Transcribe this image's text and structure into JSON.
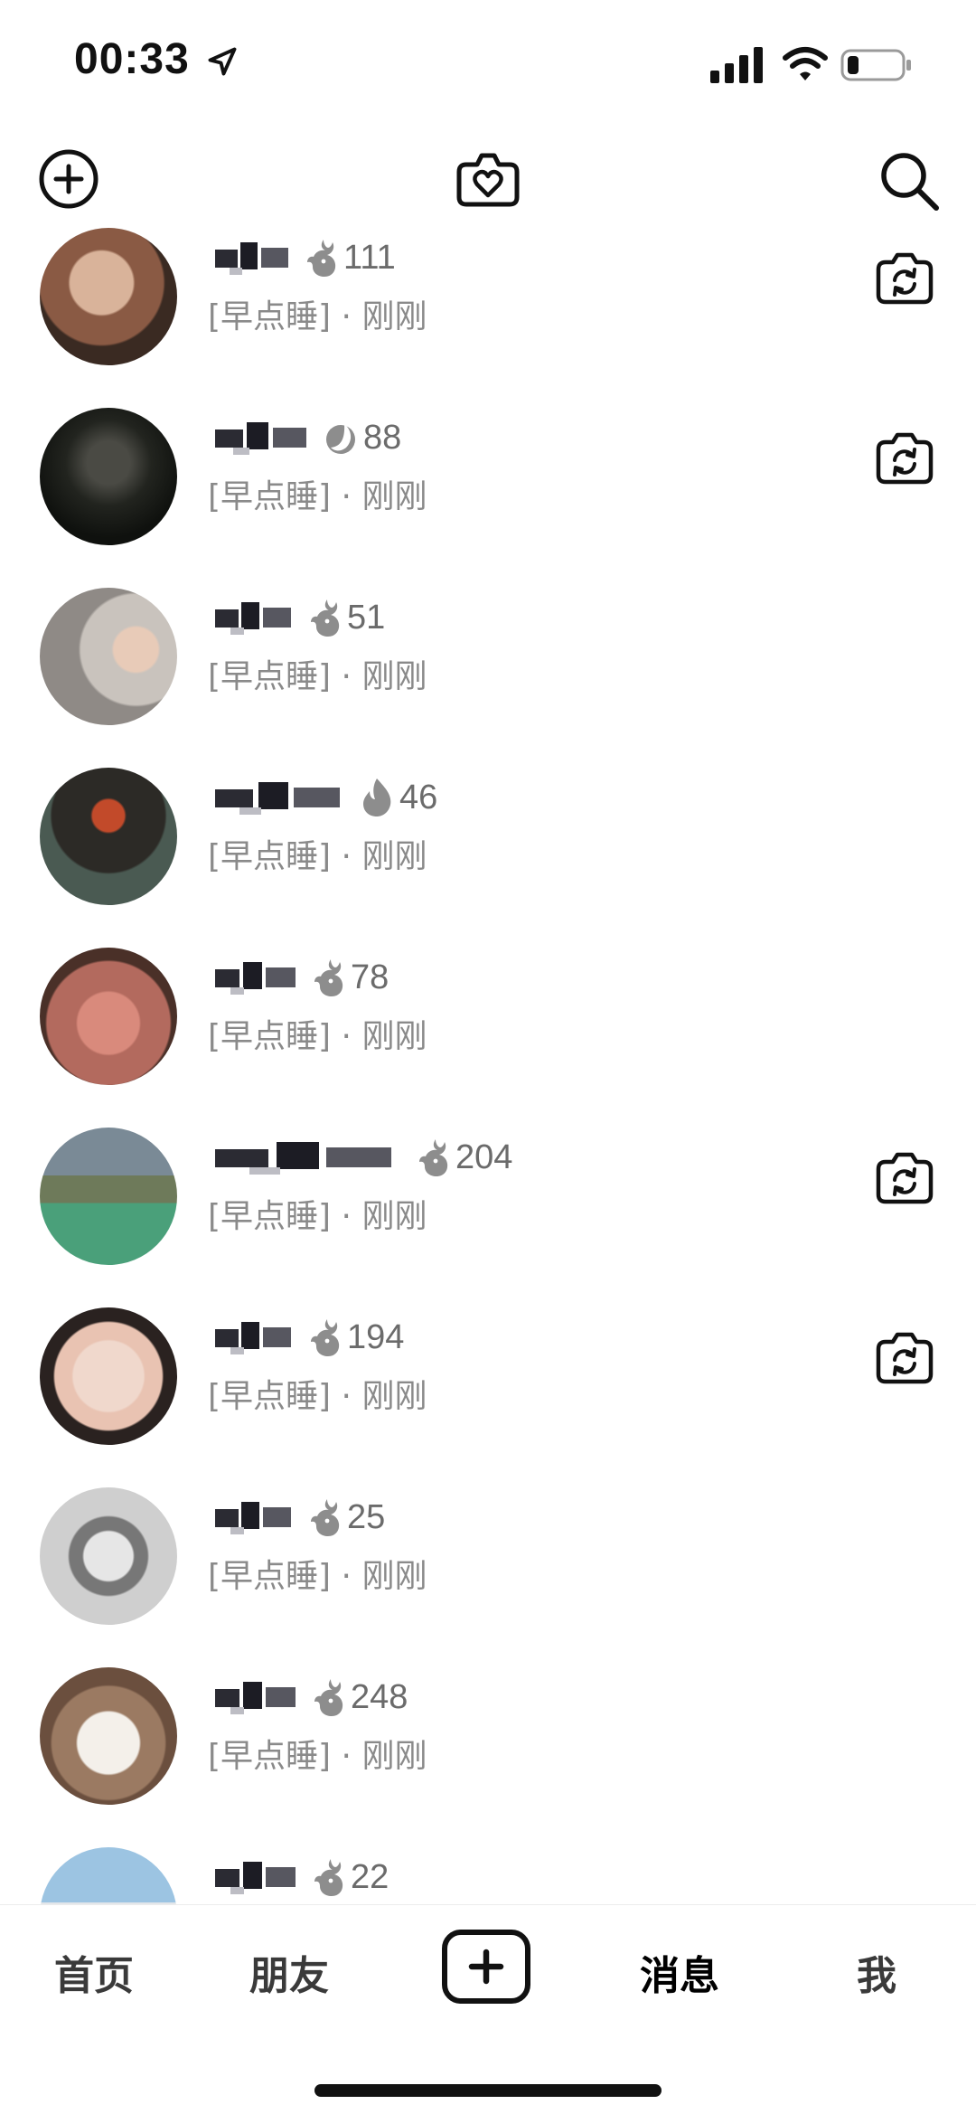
{
  "status_bar": {
    "time": "00:33",
    "battery_level": 0.22
  },
  "header": {
    "icons": [
      "add-circle-icon",
      "heart-camera-icon",
      "search-icon"
    ]
  },
  "conversations": [
    {
      "streak": "111",
      "status": "[早点睡]",
      "separator": "·",
      "time": "刚刚",
      "has_camera": true,
      "streak_icon": "fire-dragon-icon"
    },
    {
      "streak": "88",
      "status": "[早点睡]",
      "separator": "·",
      "time": "刚刚",
      "has_camera": true,
      "streak_icon": "fire-moon-icon"
    },
    {
      "streak": "51",
      "status": "[早点睡]",
      "separator": "·",
      "time": "刚刚",
      "has_camera": false,
      "streak_icon": "fire-dragon-icon"
    },
    {
      "streak": "46",
      "status": "[早点睡]",
      "separator": "·",
      "time": "刚刚",
      "has_camera": false,
      "streak_icon": "flame-icon"
    },
    {
      "streak": "78",
      "status": "[早点睡]",
      "separator": "·",
      "time": "刚刚",
      "has_camera": false,
      "streak_icon": "fire-dragon-icon"
    },
    {
      "streak": "204",
      "status": "[早点睡]",
      "separator": "·",
      "time": "刚刚",
      "has_camera": true,
      "streak_icon": "fire-dragon-icon"
    },
    {
      "streak": "194",
      "status": "[早点睡]",
      "separator": "·",
      "time": "刚刚",
      "has_camera": true,
      "streak_icon": "fire-dragon-icon"
    },
    {
      "streak": "25",
      "status": "[早点睡]",
      "separator": "·",
      "time": "刚刚",
      "has_camera": false,
      "streak_icon": "fire-dragon-icon"
    },
    {
      "streak": "248",
      "status": "[早点睡]",
      "separator": "·",
      "time": "刚刚",
      "has_camera": false,
      "streak_icon": "fire-dragon-icon"
    },
    {
      "streak": "22",
      "status": "",
      "separator": "",
      "time": "",
      "has_camera": false,
      "streak_icon": "fire-dragon-icon"
    }
  ],
  "tabbar": {
    "home": "首页",
    "friends": "朋友",
    "messages": "消息",
    "me": "我",
    "active": "messages"
  },
  "colors": {
    "text": "#111111",
    "muted": "#8a8a8a",
    "count": "#6b6b6b"
  }
}
